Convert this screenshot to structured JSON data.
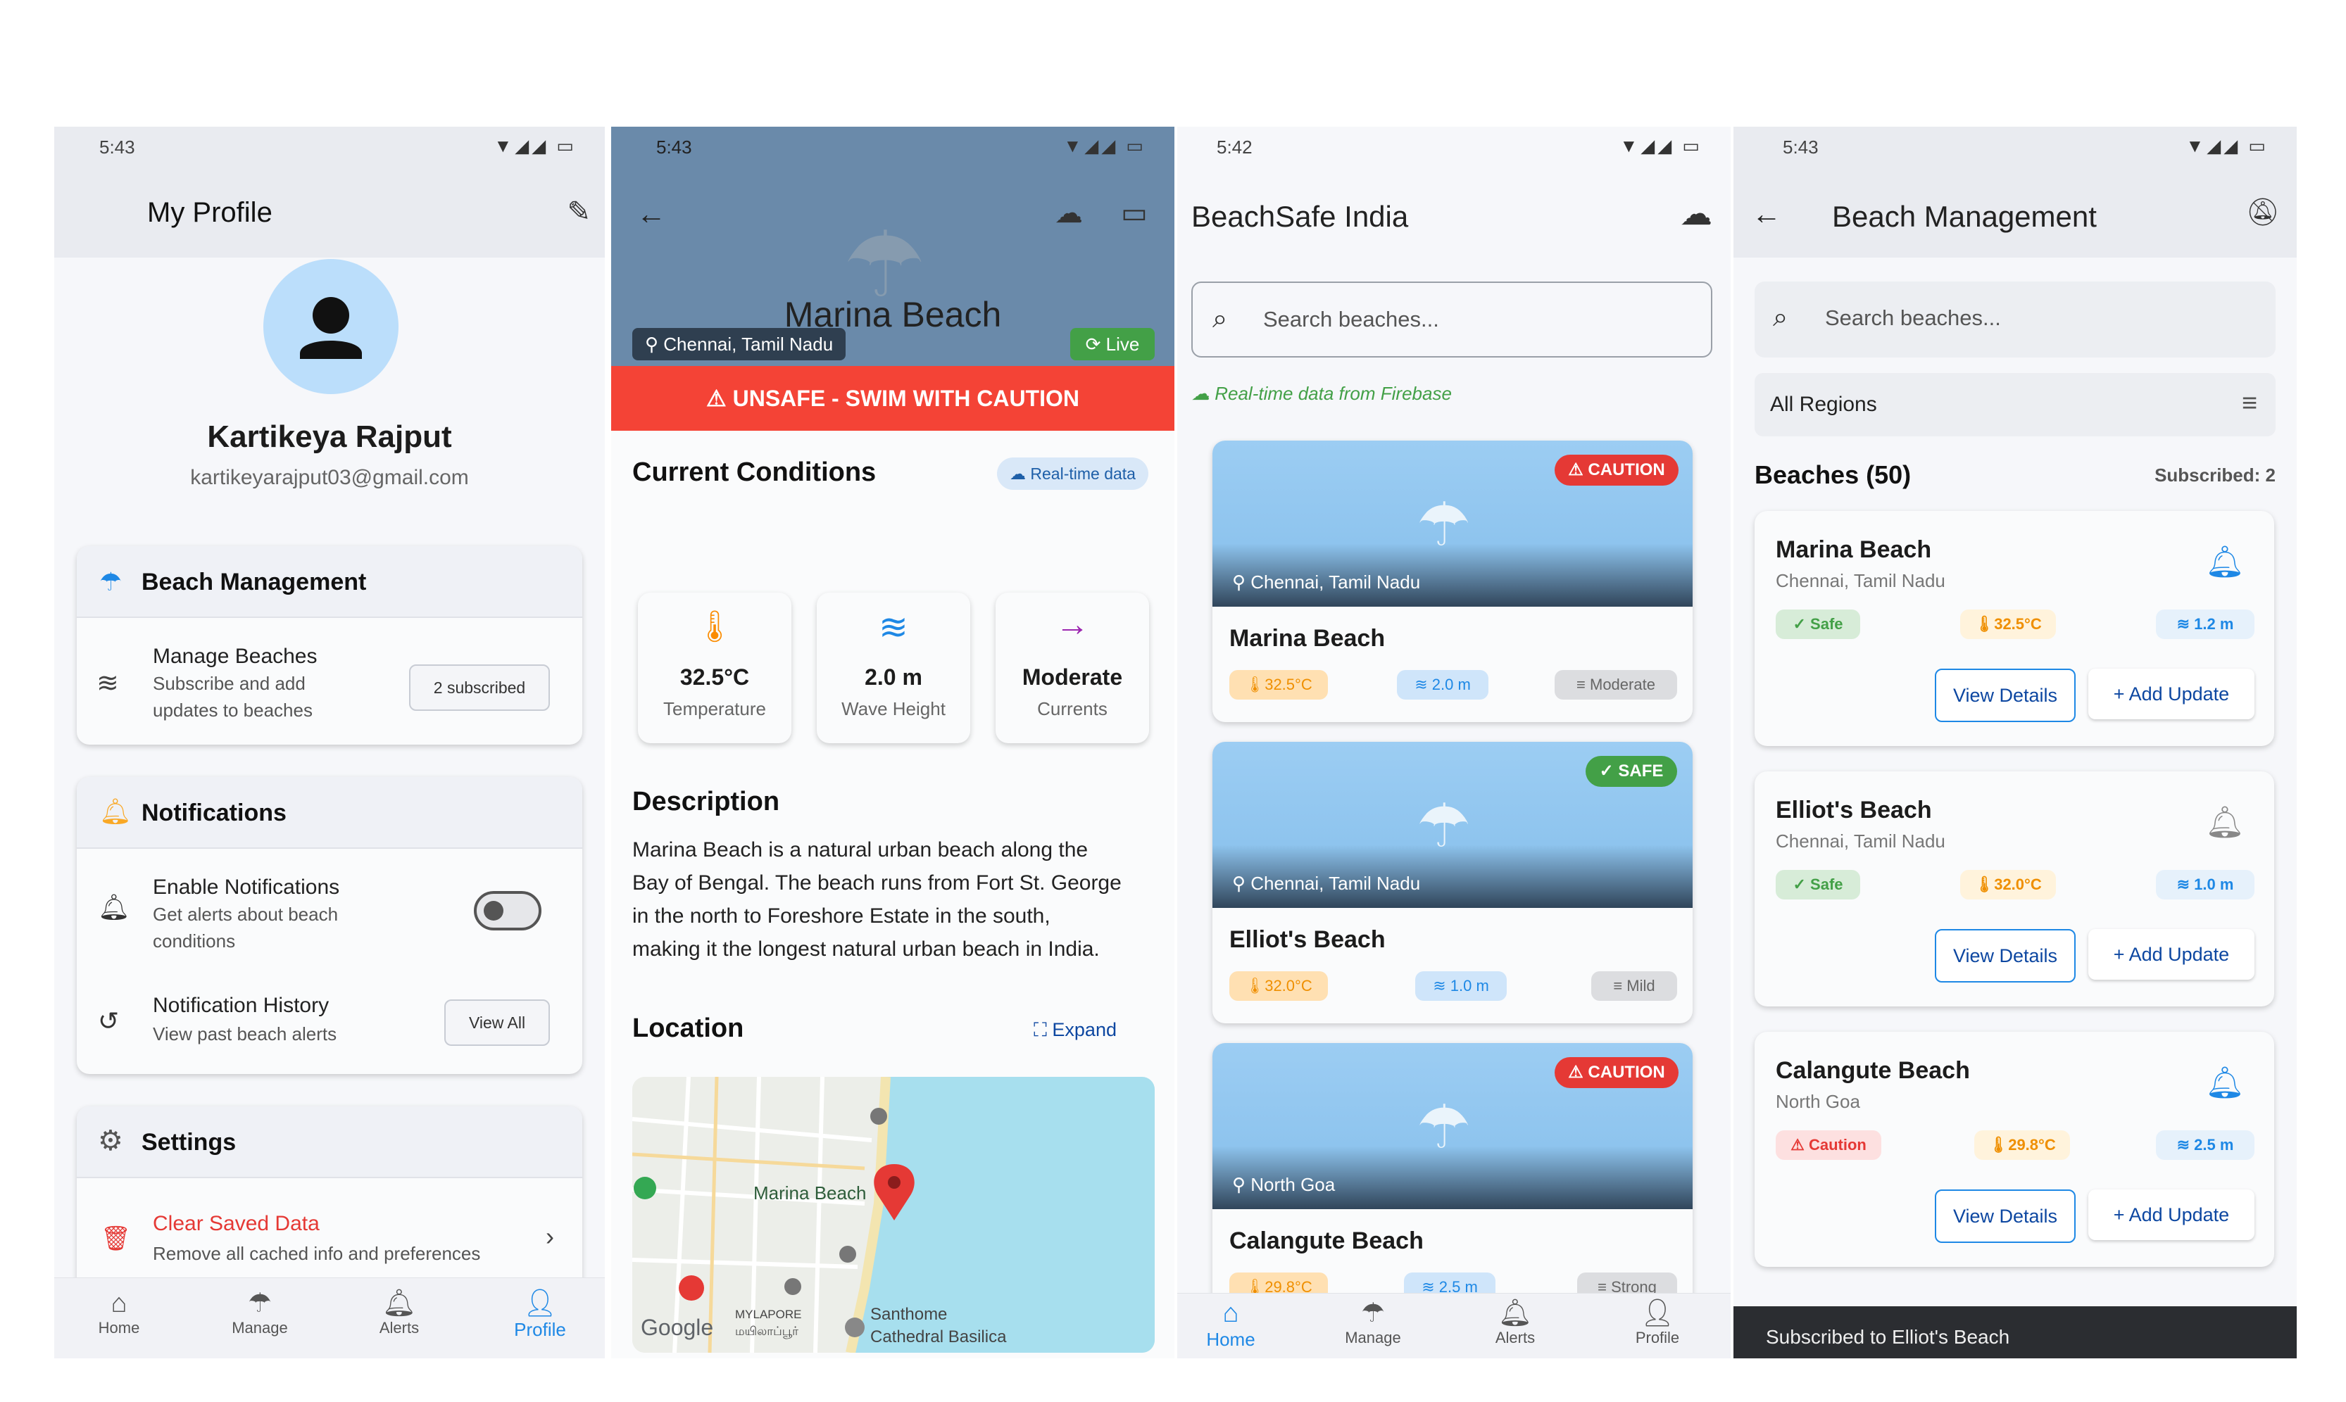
{
  "status_times": [
    "5:43",
    "5:43",
    "5:42",
    "5:43"
  ],
  "profile": {
    "title": "My Profile",
    "name": "Kartikeya Rajput",
    "email": "kartikeyarajput03@gmail.com",
    "beach_mgmt": {
      "title": "Beach Management",
      "item_title": "Manage Beaches",
      "item_sub1": "Subscribe and add",
      "item_sub2": "updates to beaches",
      "badge": "2 subscribed"
    },
    "notifications": {
      "title": "Notifications",
      "enable_title": "Enable Notifications",
      "enable_sub1": "Get alerts about beach",
      "enable_sub2": "conditions",
      "history_title": "Notification History",
      "history_sub": "View past beach alerts",
      "view_all": "View All"
    },
    "settings": {
      "title": "Settings",
      "clear_title": "Clear Saved Data",
      "clear_sub": "Remove all cached info and preferences"
    },
    "nav": [
      "Home",
      "Manage",
      "Alerts",
      "Profile"
    ]
  },
  "detail": {
    "beach_name": "Marina Beach",
    "location": "Chennai, Tamil Nadu",
    "live": "Live",
    "banner": "UNSAFE - SWIM WITH CAUTION",
    "conditions_title": "Current Conditions",
    "realtime_badge": "Real-time data",
    "cond": [
      {
        "value": "32.5°C",
        "label": "Temperature"
      },
      {
        "value": "2.0 m",
        "label": "Wave Height"
      },
      {
        "value": "Moderate",
        "label": "Currents"
      }
    ],
    "description_title": "Description",
    "description_lines": [
      "Marina Beach is a natural urban beach along the",
      "Bay of Bengal. The beach runs from Fort St. George",
      "in the north to Foreshore Estate in the south,",
      "making it the longest natural urban beach in India."
    ],
    "location_title": "Location",
    "expand": "Expand",
    "map_labels": {
      "pin": "Marina Beach",
      "place1": "Santhome",
      "place2": "Cathedral Basilica",
      "area1": "MYLAPORE",
      "area2": "மயிலாப்பூர்",
      "logo": "Google"
    }
  },
  "home": {
    "title": "BeachSafe India",
    "search_placeholder": "Search beaches...",
    "firebase_note": "Real-time data from Firebase",
    "cards": [
      {
        "name": "Marina Beach",
        "location": "Chennai, Tamil Nadu",
        "status": "CAUTION",
        "temp": "32.5°C",
        "wave": "2.0 m",
        "current": "Moderate"
      },
      {
        "name": "Elliot's Beach",
        "location": "Chennai, Tamil Nadu",
        "status": "SAFE",
        "temp": "32.0°C",
        "wave": "1.0 m",
        "current": "Mild"
      },
      {
        "name": "Calangute Beach",
        "location": "North Goa",
        "status": "CAUTION",
        "temp": "29.8°C",
        "wave": "2.5 m",
        "current": "Strong"
      }
    ],
    "nav": [
      "Home",
      "Manage",
      "Alerts",
      "Profile"
    ]
  },
  "manage": {
    "title": "Beach Management",
    "search_placeholder": "Search beaches...",
    "region": "All Regions",
    "count_label": "Beaches (50)",
    "subscribed_label": "Subscribed: 2",
    "view_details": "View Details",
    "add_update": "Add Update",
    "beaches": [
      {
        "name": "Marina Beach",
        "location": "Chennai, Tamil Nadu",
        "status": "Safe",
        "temp": "32.5°C",
        "wave": "1.2 m",
        "subscribed": true
      },
      {
        "name": "Elliot's Beach",
        "location": "Chennai, Tamil Nadu",
        "status": "Safe",
        "temp": "32.0°C",
        "wave": "1.0 m",
        "subscribed": false
      },
      {
        "name": "Calangute Beach",
        "location": "North Goa",
        "status": "Caution",
        "temp": "29.8°C",
        "wave": "2.5 m",
        "subscribed": true
      }
    ],
    "snackbar": "Subscribed to Elliot's Beach"
  },
  "colors": {
    "primary": "#1e88e5",
    "danger": "#e53935",
    "safe": "#43a047",
    "header_detail": "#6a8aaa",
    "snackbar": "#2b2d31"
  }
}
